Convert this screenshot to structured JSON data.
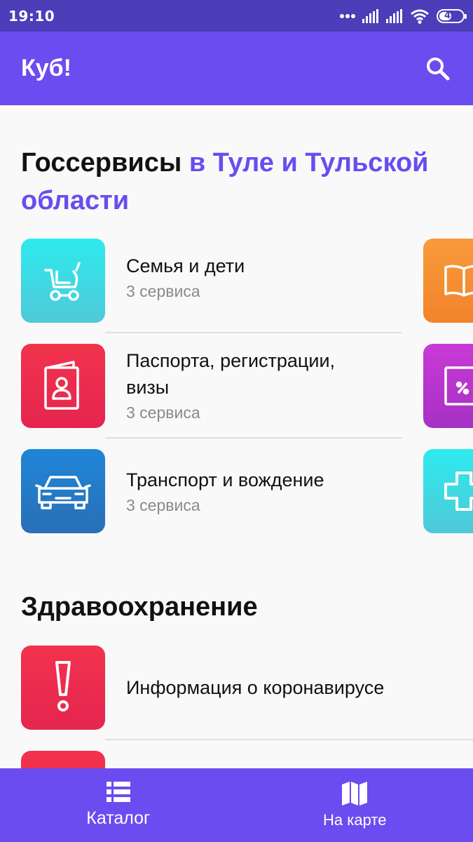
{
  "status_bar": {
    "time": "19:10",
    "battery": "48"
  },
  "app_bar": {
    "title": "Куб!",
    "search_icon": "search-icon"
  },
  "section1": {
    "title_plain": "Госсервисы",
    "title_accent_line1": "в Туле и Тульской",
    "title_accent_line2": "области",
    "items": [
      {
        "title": "Семья и дети",
        "subtitle": "3 сервиса",
        "icon": "stroller-icon",
        "color": "#3ad6e0"
      },
      {
        "title_line1": "Паспорта, регистрации,",
        "title_line2": "визы",
        "subtitle": "3 сервиса",
        "icon": "passport-icon",
        "color": "#ef2f4f"
      },
      {
        "title": "Транспорт и вождение",
        "subtitle": "3 сервиса",
        "icon": "car-icon",
        "color": "#2479c8"
      }
    ],
    "peek_tiles": [
      {
        "icon": "book-icon",
        "color": "#f5902e"
      },
      {
        "icon": "percent-document-icon",
        "color": "#c43ad2"
      },
      {
        "icon": "plus-icon",
        "color": "#3ad6e0"
      }
    ]
  },
  "section2": {
    "title": "Здравоохранение",
    "items": [
      {
        "title": "Информация о коронавирусе",
        "icon": "exclamation-icon",
        "color": "#ef2f4f"
      }
    ]
  },
  "bottom_nav": {
    "catalog_label": "Каталог",
    "map_label": "На карте",
    "catalog_icon": "list-icon",
    "map_icon": "map-icon"
  },
  "colors": {
    "status_bar": "#4c3db8",
    "primary": "#6a4cf0",
    "accent_text": "#6a4cf0"
  }
}
